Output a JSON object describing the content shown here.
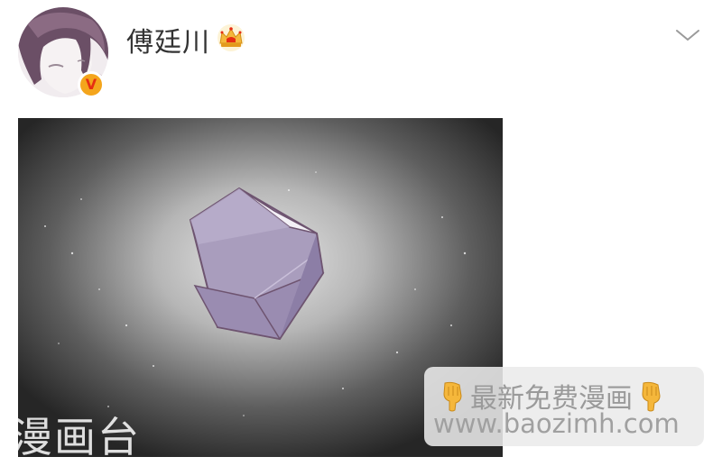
{
  "post": {
    "author": "傅廷川",
    "avatar_icon": "user-avatar",
    "verified_badge": "V",
    "verified_icon": "verified-v-icon",
    "member_icon": "crown-icon",
    "expand_icon": "chevron-down-icon"
  },
  "image": {
    "subject_icon": "purple-crystal-illustration",
    "colors": {
      "crystal": "#a396b8",
      "outline": "#6e5470",
      "background": "#2f2f2f",
      "glow": "#e6e6e6"
    }
  },
  "watermark": {
    "left_text": "漫画台",
    "title": "最新免费漫画",
    "url": "www.baozimh.com",
    "hand_icon": "pointing-down-hand-icon"
  },
  "colors": {
    "badge_orange": "#f4a51c",
    "badge_red": "#e62e12",
    "crown_gold": "#f5b73b",
    "text": "#333333"
  }
}
